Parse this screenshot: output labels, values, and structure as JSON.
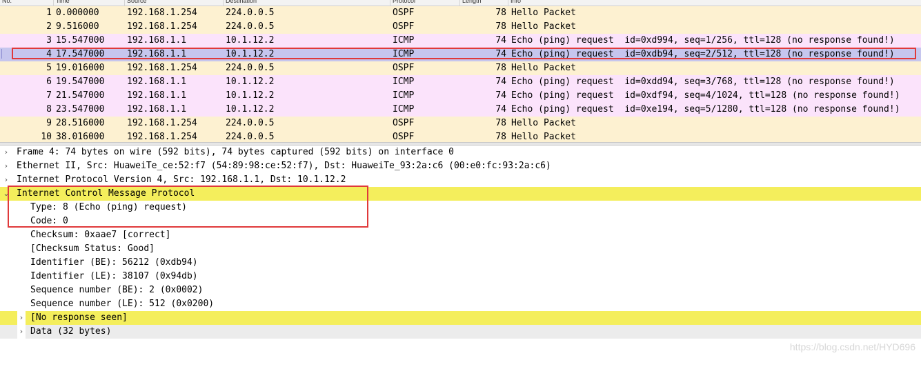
{
  "packet_list": {
    "columns": [
      "No.",
      "Time",
      "Source",
      "Destination",
      "Protocol",
      "Length",
      "Info"
    ],
    "rows": [
      {
        "no": "1",
        "time": "0.000000",
        "src": "192.168.1.254",
        "dst": "224.0.0.5",
        "proto": "OSPF",
        "len": "78",
        "info": "Hello Packet"
      },
      {
        "no": "2",
        "time": "9.516000",
        "src": "192.168.1.254",
        "dst": "224.0.0.5",
        "proto": "OSPF",
        "len": "78",
        "info": "Hello Packet"
      },
      {
        "no": "3",
        "time": "15.547000",
        "src": "192.168.1.1",
        "dst": "10.1.12.2",
        "proto": "ICMP",
        "len": "74",
        "info": "Echo (ping) request  id=0xd994, seq=1/256, ttl=128 (no response found!)"
      },
      {
        "no": "4",
        "time": "17.547000",
        "src": "192.168.1.1",
        "dst": "10.1.12.2",
        "proto": "ICMP",
        "len": "74",
        "info": "Echo (ping) request  id=0xdb94, seq=2/512, ttl=128 (no response found!)"
      },
      {
        "no": "5",
        "time": "19.016000",
        "src": "192.168.1.254",
        "dst": "224.0.0.5",
        "proto": "OSPF",
        "len": "78",
        "info": "Hello Packet"
      },
      {
        "no": "6",
        "time": "19.547000",
        "src": "192.168.1.1",
        "dst": "10.1.12.2",
        "proto": "ICMP",
        "len": "74",
        "info": "Echo (ping) request  id=0xdd94, seq=3/768, ttl=128 (no response found!)"
      },
      {
        "no": "7",
        "time": "21.547000",
        "src": "192.168.1.1",
        "dst": "10.1.12.2",
        "proto": "ICMP",
        "len": "74",
        "info": "Echo (ping) request  id=0xdf94, seq=4/1024, ttl=128 (no response found!)"
      },
      {
        "no": "8",
        "time": "23.547000",
        "src": "192.168.1.1",
        "dst": "10.1.12.2",
        "proto": "ICMP",
        "len": "74",
        "info": "Echo (ping) request  id=0xe194, seq=5/1280, ttl=128 (no response found!)"
      },
      {
        "no": "9",
        "time": "28.516000",
        "src": "192.168.1.254",
        "dst": "224.0.0.5",
        "proto": "OSPF",
        "len": "78",
        "info": "Hello Packet"
      },
      {
        "no": "10",
        "time": "38.016000",
        "src": "192.168.1.254",
        "dst": "224.0.0.5",
        "proto": "OSPF",
        "len": "78",
        "info": "Hello Packet"
      }
    ],
    "selected_no": "4"
  },
  "detail_tree": {
    "frame": "Frame 4: 74 bytes on wire (592 bits), 74 bytes captured (592 bits) on interface 0",
    "ethernet": "Ethernet II, Src: HuaweiTe_ce:52:f7 (54:89:98:ce:52:f7), Dst: HuaweiTe_93:2a:c6 (00:e0:fc:93:2a:c6)",
    "ip": "Internet Protocol Version 4, Src: 192.168.1.1, Dst: 10.1.12.2",
    "icmp": "Internet Control Message Protocol",
    "type": "Type: 8 (Echo (ping) request)",
    "code": "Code: 0",
    "checksum": "Checksum: 0xaae7 [correct]",
    "checksum_status": "[Checksum Status: Good]",
    "identifier_be": "Identifier (BE): 56212 (0xdb94)",
    "identifier_le": "Identifier (LE): 38107 (0x94db)",
    "seq_be": "Sequence number (BE): 2 (0x0002)",
    "seq_le": "Sequence number (LE): 512 (0x0200)",
    "no_response": "[No response seen]",
    "data": "Data (32 bytes)"
  },
  "icons": {
    "collapsed": "chevron-right-icon",
    "expanded": "chevron-down-icon"
  },
  "colors": {
    "ospf_row": "#fdf1d1",
    "icmp_row": "#fbe3fb",
    "selected_row": "#c6c6ee",
    "highlight": "#f4ee5c",
    "annotation_red": "#e0393a"
  },
  "watermark": "https://blog.csdn.net/HYD696"
}
